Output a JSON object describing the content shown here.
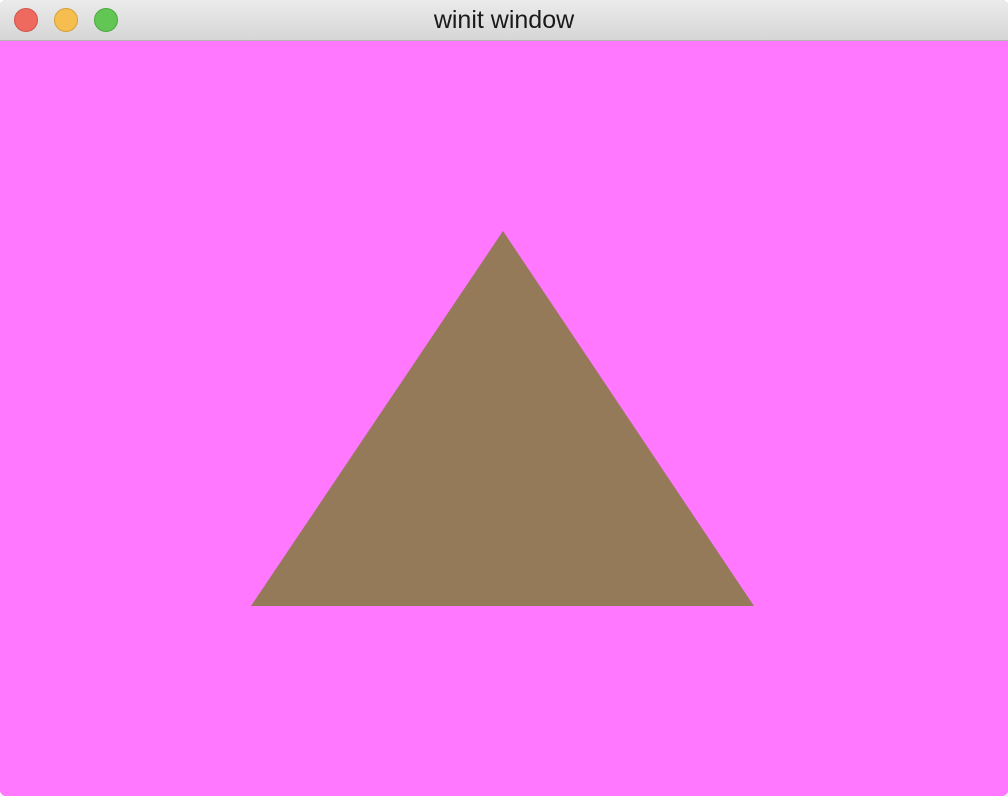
{
  "window": {
    "title": "winit window"
  },
  "titlebar_buttons": [
    {
      "name": "close",
      "icon": "close-dot-icon",
      "color": "#ee6a5f"
    },
    {
      "name": "minimize",
      "icon": "minimize-dot-icon",
      "color": "#f5be4f"
    },
    {
      "name": "zoom",
      "icon": "zoom-dot-icon",
      "color": "#62c655"
    }
  ],
  "canvas": {
    "background_color": "#ff78ff",
    "shape": {
      "type": "triangle",
      "fill_color": "#947a58"
    }
  }
}
